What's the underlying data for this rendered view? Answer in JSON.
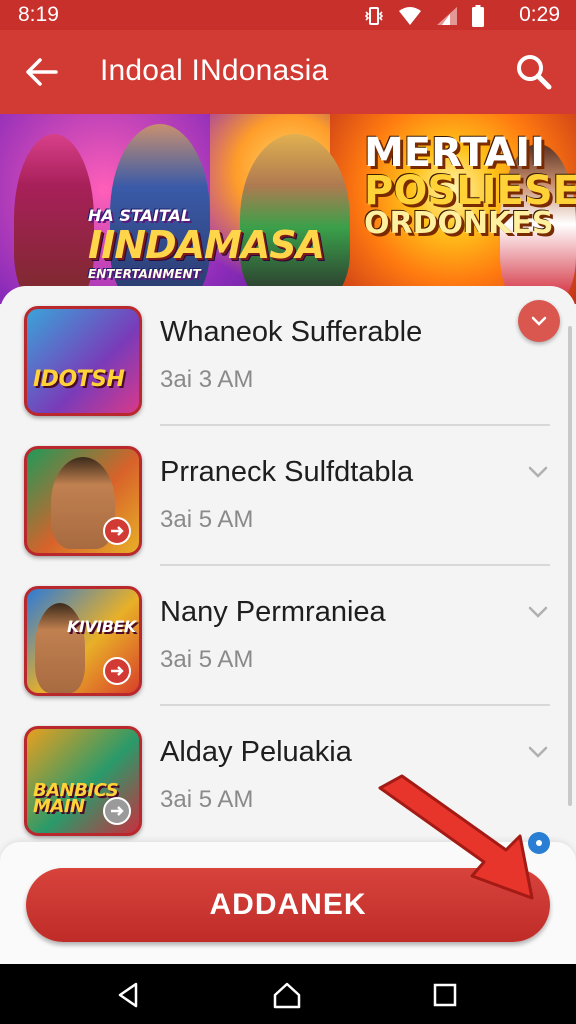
{
  "status_bar": {
    "time": "8:19",
    "clock": "0:29"
  },
  "app_bar": {
    "title": "Indoal INdonasia"
  },
  "banner": {
    "left_small": "HA STAITAL",
    "left_big": "IINDAMASA",
    "left_tag": "ENTERTAINMENT",
    "right_line1": "MERTAII",
    "right_line2": "POSLIESE",
    "right_line3": "ORDONKES"
  },
  "list": [
    {
      "title": "Whaneok Sufferable",
      "time": "3ai 3 AM",
      "thumb_text": "IDOTSH",
      "thumb_colors": [
        "#3aa3d8",
        "#7a3bb9"
      ]
    },
    {
      "title": "Prraneck Sulfdtabla",
      "time": "3ai 5 AM",
      "thumb_text": "",
      "thumb_colors": [
        "#1f9a5a",
        "#d8622a"
      ]
    },
    {
      "title": "Nany Permraniea",
      "time": "3ai 5 AM",
      "thumb_text": "KIVIBEK",
      "thumb_colors": [
        "#2d7ad8",
        "#e8b028"
      ]
    },
    {
      "title": "Alday Peluakia",
      "time": "3ai 5 AM",
      "thumb_text": "BANBICS MAIN",
      "thumb_colors": [
        "#e8a020",
        "#2a9a6a"
      ]
    }
  ],
  "action": {
    "label": "ADDANEK"
  },
  "colors": {
    "primary": "#d23a34",
    "status": "#c8302c"
  }
}
